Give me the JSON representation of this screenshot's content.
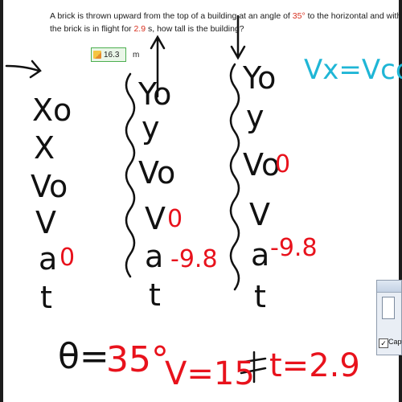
{
  "problem": {
    "part1": "A brick is thrown upward from the top of a building at an angle of ",
    "angle": "35°",
    "part2": " to the horizontal and with an initial sp",
    "part3": "the brick is in flight for ",
    "time": "2.9",
    "part4": " s, how tall is the building?"
  },
  "answer": {
    "value": "16.3",
    "unit": "m"
  },
  "notes": {
    "formula": "Vx=Vcosθ",
    "col1": [
      "Xo",
      "X",
      "Vo",
      "V",
      "a",
      "t"
    ],
    "col1_values": {
      "a": "0"
    },
    "col2": [
      "Yo",
      "y",
      "Vo",
      "V",
      "a",
      "t"
    ],
    "col2_values": {
      "V": "0",
      "a": "-9.8"
    },
    "col3": [
      "Yo",
      "y",
      "Vo",
      "V",
      "a",
      "t"
    ],
    "col3_values": {
      "Vo": "0",
      "a": "-9.8"
    },
    "theta_label": "θ=",
    "theta_value": "35°",
    "velocity": "V=15",
    "time_label": "t=2.9"
  },
  "dialog": {
    "checkbox_label": "Captu",
    "checked": "✓"
  },
  "colors": {
    "ink_black": "#111111",
    "ink_red": "#e8121c",
    "ink_cyan": "#1fb6d6",
    "answer_green": "#4caf50"
  }
}
